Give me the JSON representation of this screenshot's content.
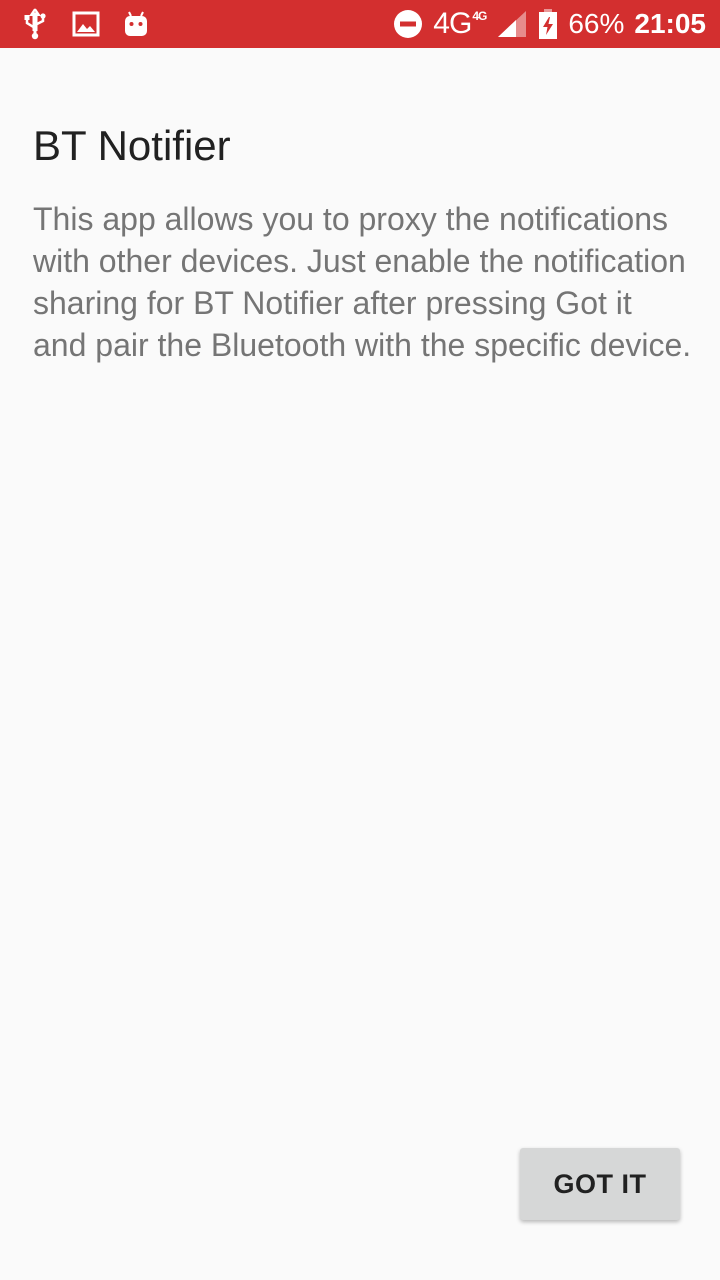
{
  "status_bar": {
    "background": "#d32f2f",
    "left_icons": [
      "usb-icon",
      "image-icon",
      "android-icon"
    ],
    "right_icons": [
      "do-not-disturb-icon",
      "signal-icon",
      "battery-charging-icon"
    ],
    "network": "4G",
    "network_secondary": "4G",
    "battery": "66%",
    "time": "21:05"
  },
  "dialog": {
    "title": "BT Notifier",
    "message": "This app allows you to proxy the notifications with other devices. Just enable the notification sharing for BT Notifier after pressing Got it and pair the Bluetooth with the specific device.",
    "button_label": "GOT IT"
  },
  "colors": {
    "background": "#fafafa",
    "title_text": "#212121",
    "body_text": "#757575",
    "button_bg": "#d6d7d7"
  }
}
